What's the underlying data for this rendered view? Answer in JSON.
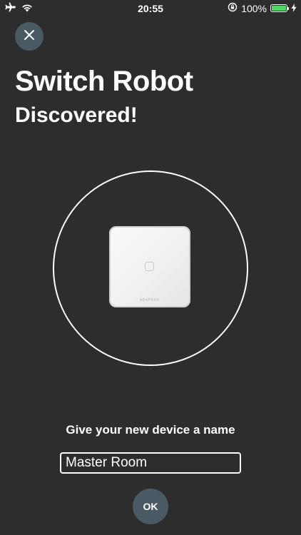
{
  "status_bar": {
    "time": "20:55",
    "battery_percent": "100%",
    "battery_level": 1.0,
    "battery_color": "#4cd964",
    "icons": [
      "airplane-icon",
      "wifi-icon",
      "orientation-lock-icon",
      "battery-icon",
      "charging-icon"
    ]
  },
  "header": {
    "title": "Switch Robot",
    "subtitle": "Discovered!"
  },
  "device": {
    "brand_label": "ADAPROX"
  },
  "form": {
    "prompt": "Give your new device a name",
    "name_value": "Master Room"
  },
  "buttons": {
    "ok_label": "OK",
    "close_icon": "close-icon"
  },
  "colors": {
    "background": "#2d2d2d",
    "button_bg": "#4a5a64"
  }
}
